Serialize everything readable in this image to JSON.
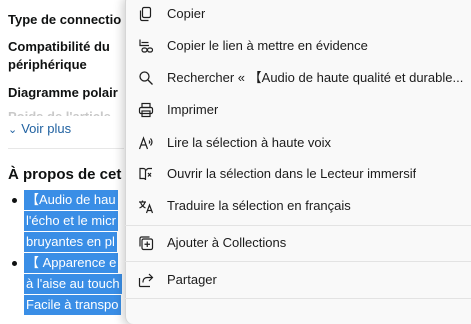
{
  "page": {
    "specs": [
      "Type de connectio",
      "Compatibilité du",
      "périphérique",
      "Diagramme polair",
      "Poids de l'article"
    ],
    "see_more": "Voir plus",
    "see_more_icon": "chevron-down-icon",
    "about_heading": "À propos de cet",
    "selected_lines": [
      "【Audio de hau",
      "l'écho et le micr",
      "bruyantes en pl",
      "【 Apparence e",
      "à l'aise au touch",
      "Facile à transpo"
    ],
    "selection_color": "#3a8ee6"
  },
  "menu": {
    "items": [
      {
        "label": "Copier",
        "icon": "copy-icon"
      },
      {
        "label": "Copier le lien à mettre en évidence",
        "icon": "link-highlight-icon"
      },
      {
        "label": "Rechercher « 【Audio de haute qualité et durable...",
        "icon": "search-icon"
      },
      {
        "label": "Imprimer",
        "icon": "print-icon"
      },
      {
        "label": "Lire la sélection à haute voix",
        "icon": "read-aloud-icon"
      },
      {
        "label": "Ouvrir la sélection dans le Lecteur immersif",
        "icon": "immersive-reader-icon"
      },
      {
        "label": "Traduire la sélection en français",
        "icon": "translate-icon"
      },
      {
        "label": "Ajouter à Collections",
        "icon": "collections-icon"
      },
      {
        "label": "Partager",
        "icon": "share-icon"
      }
    ]
  }
}
